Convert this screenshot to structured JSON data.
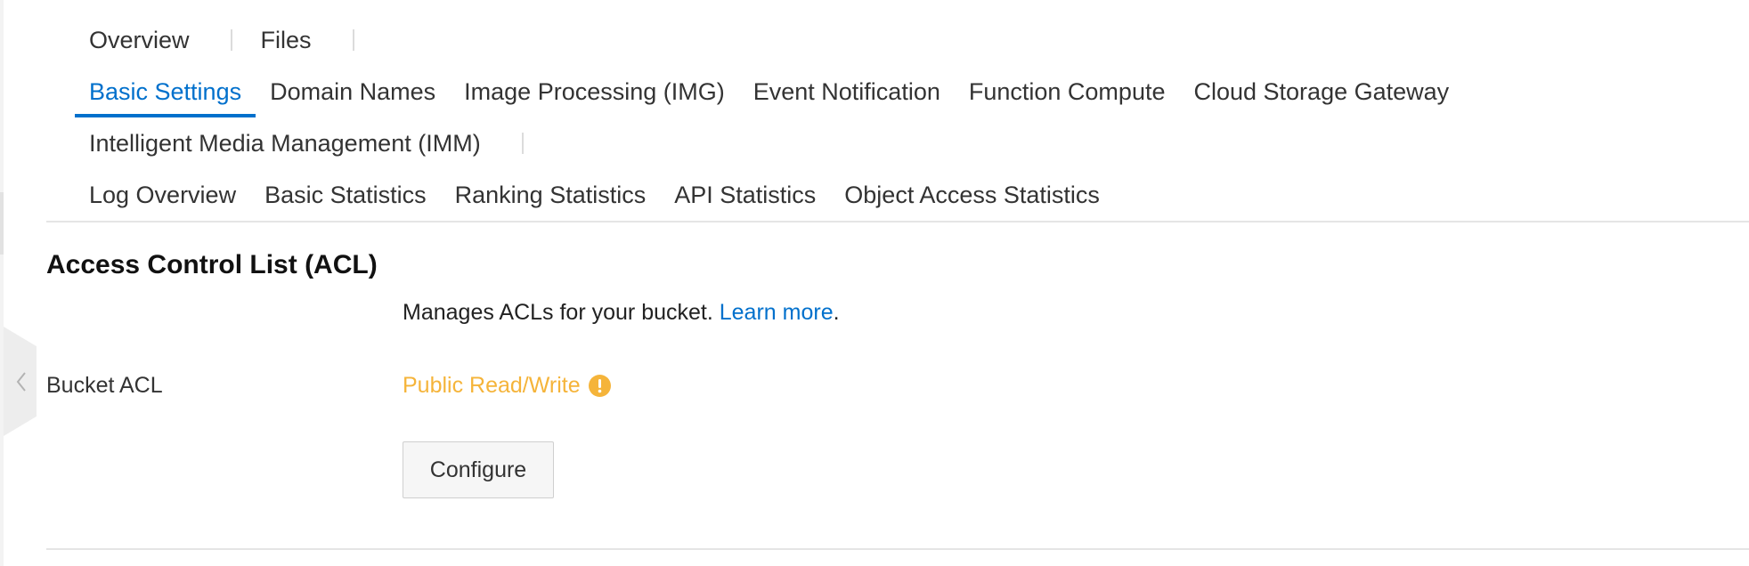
{
  "tabs": {
    "row1": [
      "Overview",
      "Files"
    ],
    "row2": [
      "Basic Settings",
      "Domain Names",
      "Image Processing (IMG)",
      "Event Notification",
      "Function Compute",
      "Cloud Storage Gateway"
    ],
    "row3": [
      "Intelligent Media Management (IMM)"
    ],
    "row4": [
      "Log Overview",
      "Basic Statistics",
      "Ranking Statistics",
      "API Statistics",
      "Object Access Statistics"
    ],
    "active": "Basic Settings"
  },
  "section": {
    "title": "Access Control List (ACL)",
    "description": "Manages ACLs for your bucket.",
    "learn_more": "Learn more",
    "period": "."
  },
  "bucket_acl": {
    "label": "Bucket ACL",
    "value": "Public Read/Write",
    "warning_icon": "exclamation-circle-icon",
    "configure_label": "Configure"
  },
  "colors": {
    "accent": "#0070cc",
    "warning": "#f5b43a"
  }
}
